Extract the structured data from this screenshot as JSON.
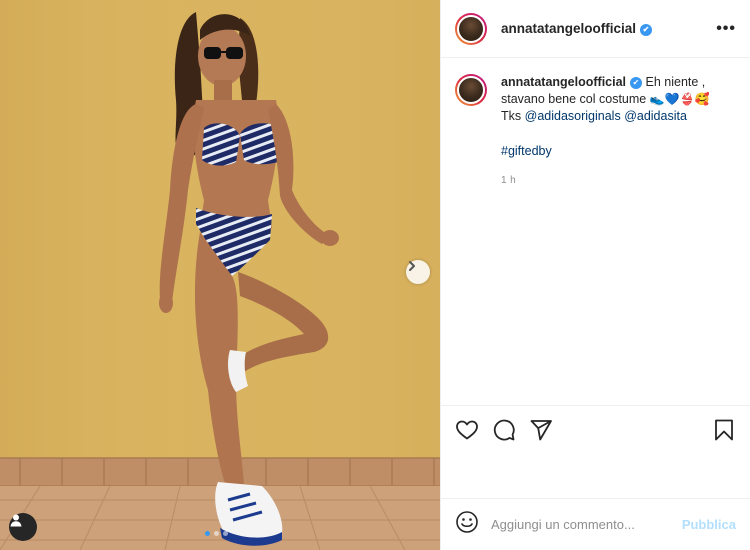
{
  "post": {
    "username": "annatatangeloofficial",
    "verified_badge": "✔",
    "more_options": "•••",
    "caption": {
      "username": "annatatangeloofficial",
      "line1": "Eh niente ,",
      "line2_text": "stavano bene col costume",
      "line2_emoji": "👟💙👙🥰",
      "line3_prefix": "Tks",
      "mention1": "@adidasoriginals",
      "mention2": "@adidasita",
      "hashtag": "#giftedby",
      "timestamp": "1 h"
    },
    "comment_input": {
      "placeholder": "Aggiungi un commento...",
      "value": ""
    },
    "publish_label": "Pubblica",
    "carousel": {
      "slides": 3,
      "active_index": 0
    }
  },
  "icons": {
    "heart": "heart-icon",
    "comment": "comment-icon",
    "share": "share-icon",
    "bookmark": "bookmark-icon",
    "emoji": "emoji-icon",
    "next": "chevron-right-icon",
    "user_tag": "user-tag-icon"
  },
  "colors": {
    "accent": "#3897f0",
    "publish_disabled": "#b2dffc",
    "link": "#00376b",
    "wall": "#d9b35f",
    "tiles": "#c99a6d"
  }
}
